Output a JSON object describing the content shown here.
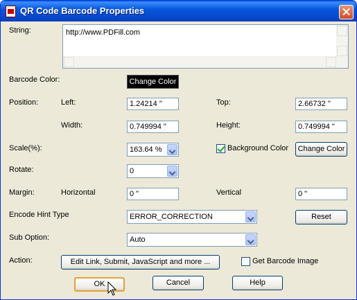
{
  "window": {
    "title": "QR Code Barcode Properties"
  },
  "string": {
    "label": "String:",
    "value": "http://www.PDFill.com"
  },
  "barcode_color": {
    "label": "Barcode Color:",
    "button": "Change Color"
  },
  "position": {
    "label": "Position:",
    "left_label": "Left:",
    "left_value": "1.24214 \"",
    "top_label": "Top:",
    "top_value": "2.66732 \"",
    "width_label": "Width:",
    "width_value": "0.749994 \"",
    "height_label": "Height:",
    "height_value": "0.749994 \""
  },
  "scale": {
    "label": "Scale(%):",
    "value": "163.64 %"
  },
  "background": {
    "label": "Background Color",
    "checked": true,
    "button": "Change Color"
  },
  "rotate": {
    "label": "Rotate:",
    "value": "0"
  },
  "margin": {
    "label": "Margin:",
    "horizontal_label": "Horizontal",
    "horizontal_value": "0 \"",
    "vertical_label": "Vertical",
    "vertical_value": "0 \""
  },
  "encode_hint": {
    "label": "Encode Hint Type",
    "value": "ERROR_CORRECTION",
    "reset_button": "Reset"
  },
  "sub_option": {
    "label": "Sub Option:",
    "value": "Auto"
  },
  "action": {
    "label": "Action:",
    "button": "Edit Link, Submit, JavaScript and more ...",
    "get_image_label": "Get Barcode Image",
    "get_image_checked": false
  },
  "footer": {
    "ok": "OK",
    "cancel": "Cancel",
    "help": "Help"
  }
}
